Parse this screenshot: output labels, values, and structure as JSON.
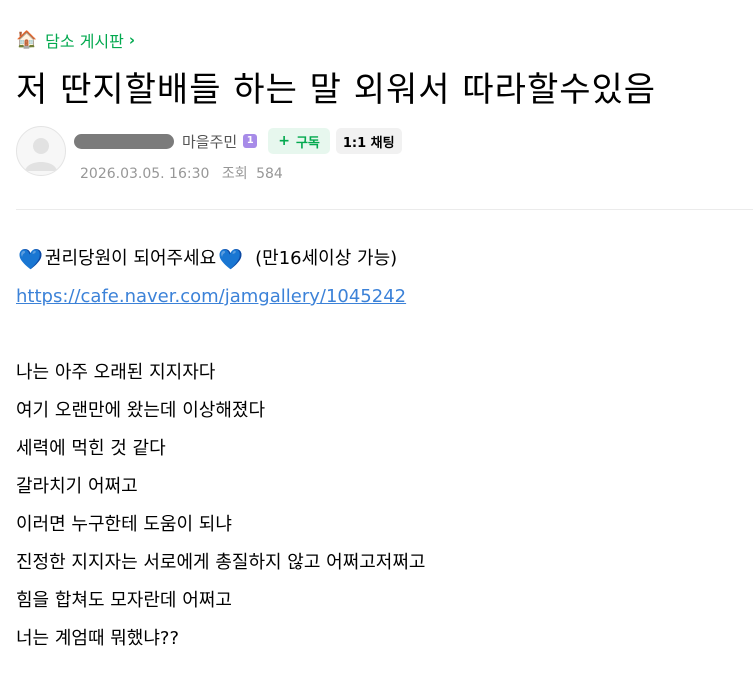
{
  "board": {
    "icon": "house-icon",
    "name": "담소 게시판",
    "chevron": "chevron-right-icon"
  },
  "post": {
    "title": "저 딴지할배들 하는 말 외워서 따라할수있음"
  },
  "author": {
    "name_redacted": "",
    "grade": "마을주민",
    "level_badge": "1",
    "level_badge_color": "#a78be8",
    "subscribe_label": "구독",
    "chat_label": "1:1 채팅",
    "date": "2026.03.05. 16:30",
    "views_label": "조회",
    "views_count": "584"
  },
  "content": {
    "promo_text": "권리당원이 되어주세요",
    "promo_note": "(만16세이상 가능)",
    "heart_icon": "blue-heart-icon",
    "heart_color": "#3b82f6",
    "link": "https://cafe.naver.com/jamgallery/1045242",
    "lines": [
      "나는 아주 오래된 지지자다",
      "여기 오랜만에 왔는데 이상해졌다",
      "세력에 먹힌 것 같다",
      "갈라치기 어쩌고",
      "이러면 누구한테 도움이 되냐",
      "진정한 지지자는 서로에게 총질하지 않고 어쩌고저쩌고",
      "힘을 합쳐도 모자란데 어쩌고",
      "너는 계엄때 뭐했냐??"
    ]
  },
  "colors": {
    "accent_green": "#03a94f",
    "link_blue": "#3c82d8",
    "meta_gray": "#979797"
  }
}
